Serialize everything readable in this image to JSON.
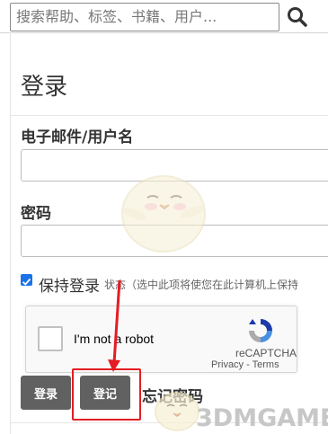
{
  "search": {
    "placeholder": "搜索帮助、标签、书籍、用户..."
  },
  "page": {
    "title": "登录"
  },
  "form": {
    "username_label": "电子邮件/用户名",
    "password_label": "密码",
    "remember_label": "保持登录",
    "remember_hint": "状态（选中此项将使您在此计算机上保持",
    "remember_checked": true
  },
  "recaptcha": {
    "prompt": "I'm not a robot",
    "brand": "reCAPTCHA",
    "links": "Privacy - Terms"
  },
  "buttons": {
    "login": "登录",
    "register": "登记",
    "forgot_password": "忘记密码"
  },
  "colors": {
    "button_bg": "#616161",
    "checkbox_accent": "#1a73e8",
    "annotation_red": "#e51c23"
  },
  "watermark": {
    "text": "3DMGAME"
  }
}
